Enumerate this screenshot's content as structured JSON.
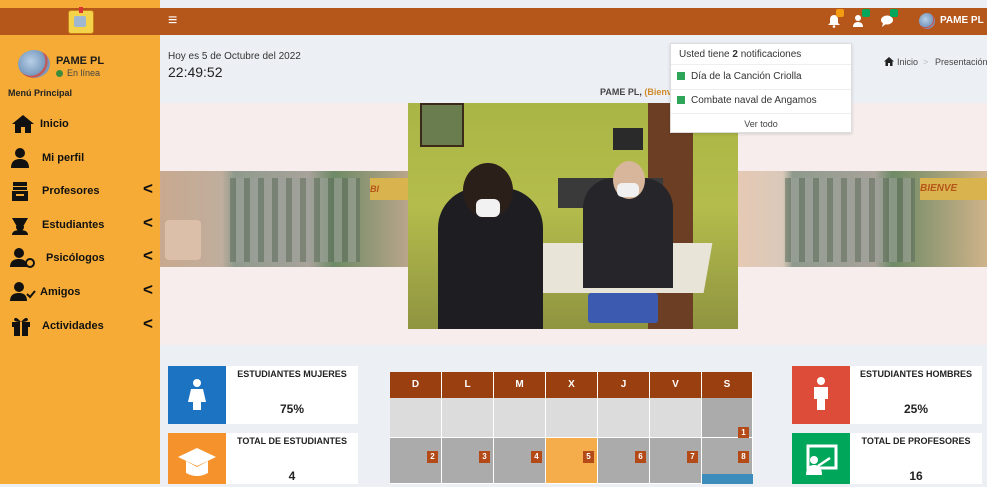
{
  "sidebar": {
    "user_name": "PAME PL",
    "user_status": "En línea",
    "menu_header": "Menú Principal",
    "items": [
      {
        "label": "Inicio"
      },
      {
        "label": "Mi perfil"
      },
      {
        "label": "Profesores"
      },
      {
        "label": "Estudiantes"
      },
      {
        "label": "Psicólogos"
      },
      {
        "label": "Amigos"
      },
      {
        "label": "Actividades"
      }
    ],
    "colors": {
      "background": "#f5ab35",
      "header": "#b5561a"
    }
  },
  "topbar": {
    "menu_icon": "≡",
    "username": "PAME PL",
    "icons": [
      "bell-icon",
      "user-add-icon",
      "chat-icon"
    ],
    "badges": [
      "",
      "",
      ""
    ]
  },
  "content": {
    "date_text": "Hoy es 5 de Octubre del 2022",
    "time_text": "22:49:52",
    "welcome_name": "PAME PL,",
    "welcome_rest": "(Bienve",
    "breadcrumb": {
      "home": "Inicio",
      "current": "Presentación"
    }
  },
  "notifications": {
    "header_prefix": "Usted tiene",
    "count": "2",
    "header_suffix": "notificaciones",
    "items": [
      "Día de la Canción Criolla",
      "Combate naval de Angamos"
    ],
    "view_all": "Ver todo"
  },
  "stats": [
    {
      "title": "ESTUDIANTES MUJERES",
      "value": "75%",
      "color": "#1b73c1",
      "icon": "female-student-icon"
    },
    {
      "title": "TOTAL DE ESTUDIANTES",
      "value": "4",
      "color": "#f5922b",
      "icon": "graduation-cap-icon"
    },
    {
      "title": "ESTUDIANTES HOMBRES",
      "value": "25%",
      "color": "#dd4b39",
      "icon": "male-student-icon"
    },
    {
      "title": "TOTAL DE PROFESORES",
      "value": "16",
      "color": "#00a65a",
      "icon": "teacher-icon"
    }
  ],
  "calendar": {
    "days": [
      "D",
      "L",
      "M",
      "X",
      "J",
      "V",
      "S"
    ],
    "week1": [
      "",
      "",
      "",
      "",
      "",
      "",
      "1"
    ],
    "week2": [
      "2",
      "3",
      "4",
      "5",
      "6",
      "7",
      "8"
    ],
    "today": "5"
  },
  "gallery": {
    "photo_label": "BIENVE"
  }
}
